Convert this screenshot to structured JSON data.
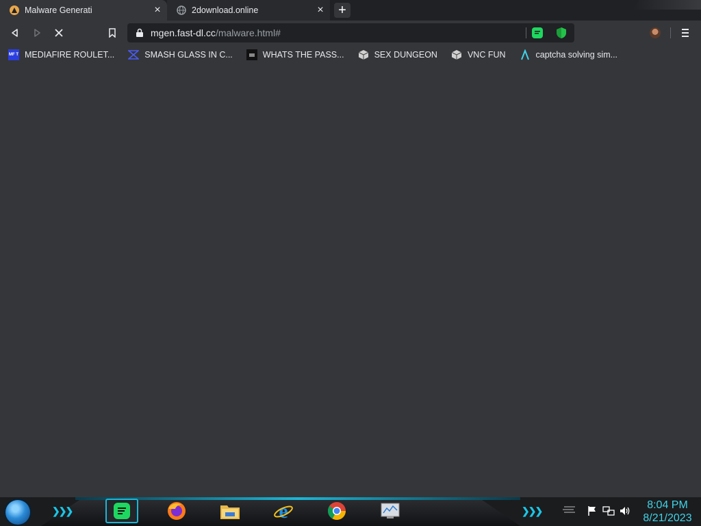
{
  "tabs": [
    {
      "title": "Malware Generati",
      "close": "×",
      "favicon": "warning-icon"
    },
    {
      "title": "2download.online",
      "close": "×",
      "favicon": "globe-icon"
    }
  ],
  "new_tab_label": "+",
  "toolbar": {
    "url_host": "mgen.fast-dl.cc",
    "url_path": "/malware.html#",
    "loading": true
  },
  "bookmarks": [
    {
      "label": "MEDIAFIRE ROULET...",
      "icon": "mft-icon",
      "icon_text": "MF T"
    },
    {
      "label": "SMASH GLASS IN C...",
      "icon": "chevron-logo-icon"
    },
    {
      "label": "WHATS THE PASS...",
      "icon": "box-icon"
    },
    {
      "label": "SEX DUNGEON",
      "icon": "cube-icon"
    },
    {
      "label": "VNC FUN",
      "icon": "cube-icon"
    },
    {
      "label": "captcha solving sim...",
      "icon": "lambda-icon"
    }
  ],
  "taskbar": {
    "apps": [
      "spotify-icon",
      "firefox-icon",
      "file-explorer-icon",
      "internet-explorer-icon",
      "chrome-icon",
      "task-manager-icon"
    ],
    "time": "8:04 PM",
    "date": "8/21/2023"
  },
  "colors": {
    "tab_strip": "#202124",
    "toolbar": "#35363a",
    "accent": "#1bb6d6",
    "clock": "#3fd4e8"
  }
}
